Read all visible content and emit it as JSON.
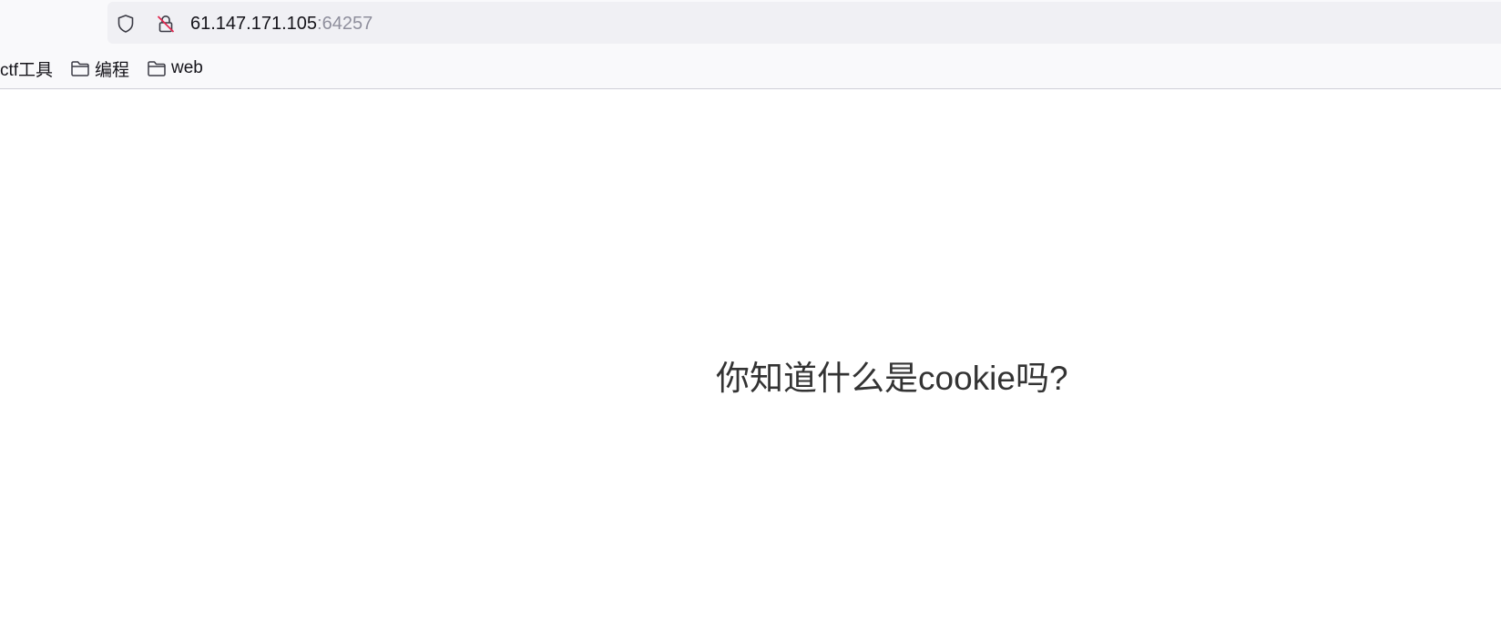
{
  "browser": {
    "address_bar": {
      "host": "61.147.171.105",
      "port": ":64257",
      "icons": [
        "shield-icon",
        "insecure-lock-icon"
      ]
    },
    "bookmarks_bar": {
      "items": [
        {
          "label": "ctf工具",
          "icon": null
        },
        {
          "label": "编程",
          "icon": "folder-icon"
        },
        {
          "label": "web",
          "icon": "folder-icon"
        }
      ]
    }
  },
  "page": {
    "heading": "你知道什么是cookie吗?"
  },
  "colors": {
    "toolbar_bg": "#f9f9fb",
    "urlbar_bg": "#f0f0f4",
    "url_host": "#15141a",
    "url_port": "#8f8f9d",
    "insecure_slash": "#e22850",
    "heading": "#333333"
  }
}
